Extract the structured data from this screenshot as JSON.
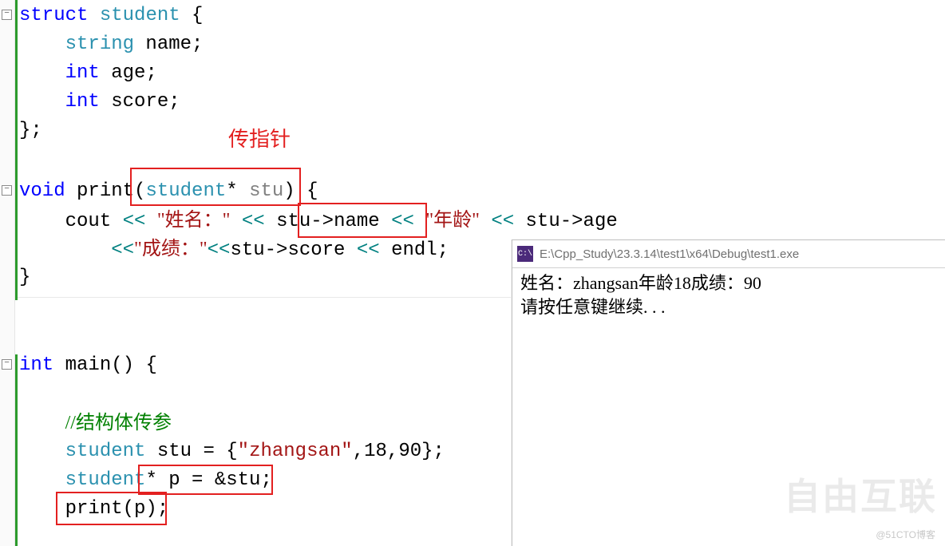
{
  "annotation": {
    "pointer_label": "传指针"
  },
  "code": {
    "l1": {
      "struct": "struct",
      "student": "student",
      "brace": " {"
    },
    "l2": {
      "indent": "    ",
      "type": "string",
      "name": " name;"
    },
    "l3": {
      "indent": "    ",
      "type": "int",
      "name": " age;"
    },
    "l4": {
      "indent": "    ",
      "type": "int",
      "name": " score;"
    },
    "l5": "};",
    "l7": {
      "void": "void",
      "space": " ",
      "print": "print",
      "open": "(",
      "param_type": "student",
      "star": "* ",
      "param": "stu",
      "close": ") {"
    },
    "l8": {
      "indent": "    ",
      "cout": "cout ",
      "op1": "<< ",
      "s1": "\"姓名：\"",
      "sp1": " ",
      "op2": "<< ",
      "expr1": "stu->name ",
      "op3": "<< ",
      "s2": "\"年龄\"",
      "sp2": " ",
      "op4": "<< ",
      "expr2": "stu->age"
    },
    "l9": {
      "indent": "        ",
      "op1": "<<",
      "s1": "\"成绩：\"",
      "op2": "<<",
      "expr1": "stu->score ",
      "op3": "<< ",
      "endl": "endl;"
    },
    "l10": "}",
    "l12": {
      "int": "int",
      "main": " main() {"
    },
    "l14": {
      "indent": "    ",
      "comment": "//结构体传参"
    },
    "l15": {
      "indent": "    ",
      "type": "student",
      "sp": " ",
      "var": "stu = {",
      "str": "\"zhangsan\"",
      "rest": ",18,90};"
    },
    "l16": {
      "indent": "    ",
      "type": "student",
      "rest": "* p = &stu;"
    },
    "l17": {
      "indent": "    ",
      "call": "print(p);"
    }
  },
  "console": {
    "title": "E:\\Cpp_Study\\23.3.14\\test1\\x64\\Debug\\test1.exe",
    "icon_text": "C:\\",
    "line1": "姓名：zhangsan年龄18成绩：90",
    "line2": "请按任意键继续. . ."
  },
  "watermark": {
    "text": "自由互联",
    "blog": "@51CTO博客"
  }
}
